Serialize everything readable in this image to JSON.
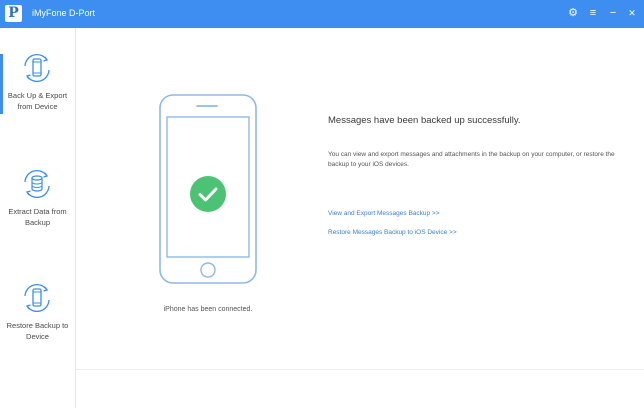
{
  "window": {
    "logo_letter": "P",
    "title": "iMyFone D-Port",
    "settings_glyph": "⚙",
    "menu_glyph": "≡",
    "minimize_glyph": "−",
    "close_glyph": "✕"
  },
  "sidebar": {
    "items": [
      {
        "label": "Back Up & Export from Device",
        "icon": "phone-sync-icon",
        "active": true
      },
      {
        "label": "Extract Data from Backup",
        "icon": "database-sync-icon",
        "active": false
      },
      {
        "label": "Restore Backup to Device",
        "icon": "phone-restore-icon",
        "active": false
      }
    ]
  },
  "main": {
    "phone_caption": "iPhone has been connected.",
    "status_title": "Messages have been backed up successfully.",
    "description": "You can view and export messages and attachments in the backup on your computer, or restore the backup to your iOS devices.",
    "links": {
      "view_export": "View and Export Messages Backup >>",
      "restore": "Restore Messages Backup to iOS Device >>"
    },
    "success_icon": "check-circle-icon"
  },
  "colors": {
    "accent": "#3d8ef0",
    "success": "#4cc274",
    "link": "#3d7fd6",
    "phone_outline": "#8fb9e6"
  }
}
